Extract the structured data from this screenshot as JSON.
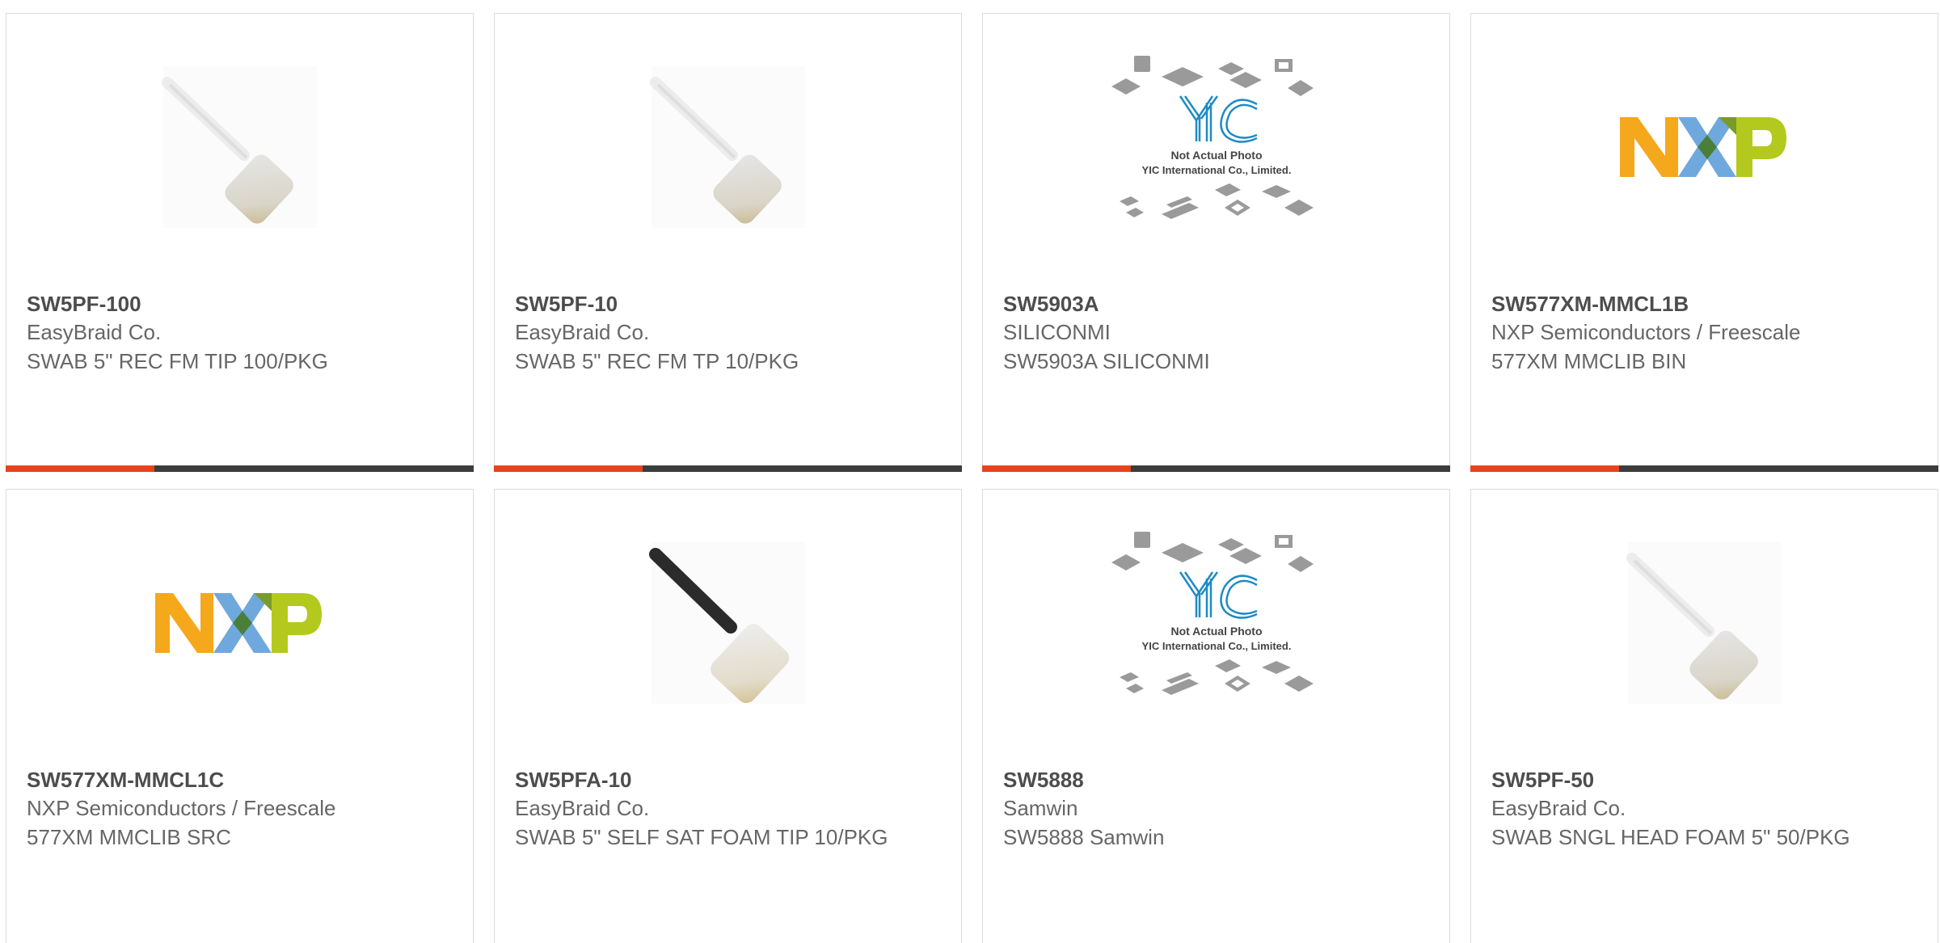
{
  "colors": {
    "accent": "#e8421c",
    "bar": "#3c3c3c",
    "border": "#dcdcdc"
  },
  "products": [
    {
      "part": "SW5PF-100",
      "manufacturer": "EasyBraid Co.",
      "description": "SWAB 5\" REC FM TIP 100/PKG",
      "image": "foam-swab-white"
    },
    {
      "part": "SW5PF-10",
      "manufacturer": "EasyBraid Co.",
      "description": "SWAB 5\" REC FM TP 10/PKG",
      "image": "foam-swab-white"
    },
    {
      "part": "SW5903A",
      "manufacturer": "SILICONMI",
      "description": "SW5903A SILICONMI",
      "image": "yic-placeholder",
      "image_text": {
        "logo": "YIC",
        "line1": "Not Actual Photo",
        "line2": "YIC International Co., Limited."
      }
    },
    {
      "part": "SW577XM-MMCL1B",
      "manufacturer": "NXP Semiconductors / Freescale",
      "description": "577XM MMCLIB BIN",
      "image": "nxp-logo",
      "image_text": {
        "logo": "NXP"
      }
    },
    {
      "part": "SW577XM-MMCL1C",
      "manufacturer": "NXP Semiconductors / Freescale",
      "description": "577XM MMCLIB SRC",
      "image": "nxp-logo",
      "image_text": {
        "logo": "NXP"
      }
    },
    {
      "part": "SW5PFA-10",
      "manufacturer": "EasyBraid Co.",
      "description": "SWAB 5\" SELF SAT FOAM TIP 10/PKG",
      "image": "foam-swab-black"
    },
    {
      "part": "SW5888",
      "manufacturer": "Samwin",
      "description": "SW5888 Samwin",
      "image": "yic-placeholder",
      "image_text": {
        "logo": "YIC",
        "line1": "Not Actual Photo",
        "line2": "YIC International Co., Limited."
      }
    },
    {
      "part": "SW5PF-50",
      "manufacturer": "EasyBraid Co.",
      "description": "SWAB SNGL HEAD FOAM 5\" 50/PKG",
      "image": "foam-swab-white"
    }
  ]
}
